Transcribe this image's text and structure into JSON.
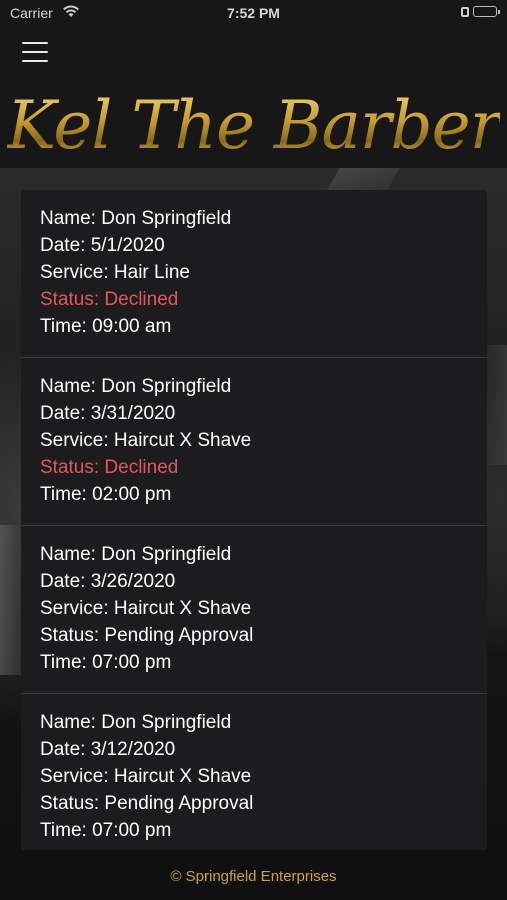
{
  "status_bar": {
    "carrier": "Carrier",
    "time": "7:52 PM"
  },
  "header": {
    "logo_text": "Kel The Barber",
    "menu_icon": "hamburger-menu-icon"
  },
  "colors": {
    "gold": "#c9a43a",
    "declined": "#e0585b",
    "card_bg": "#1c1c1e"
  },
  "appointments": [
    {
      "name": "Name: Don Springfield",
      "date": "Date: 5/1/2020",
      "service": "Service: Hair Line",
      "status": "Status: Declined",
      "status_state": "declined",
      "time": "Time: 09:00 am"
    },
    {
      "name": "Name: Don Springfield",
      "date": "Date: 3/31/2020",
      "service": "Service: Haircut X Shave",
      "status": "Status: Declined",
      "status_state": "declined",
      "time": "Time: 02:00 pm"
    },
    {
      "name": "Name: Don Springfield",
      "date": "Date: 3/26/2020",
      "service": "Service: Haircut X Shave",
      "status": "Status: Pending Approval",
      "status_state": "pending",
      "time": "Time: 07:00 pm"
    },
    {
      "name": "Name: Don Springfield",
      "date": "Date: 3/12/2020",
      "service": "Service: Haircut X Shave",
      "status": "Status: Pending Approval",
      "status_state": "pending",
      "time": "Time: 07:00 pm"
    }
  ],
  "footer": {
    "copyright": "© Springfield Enterprises"
  }
}
